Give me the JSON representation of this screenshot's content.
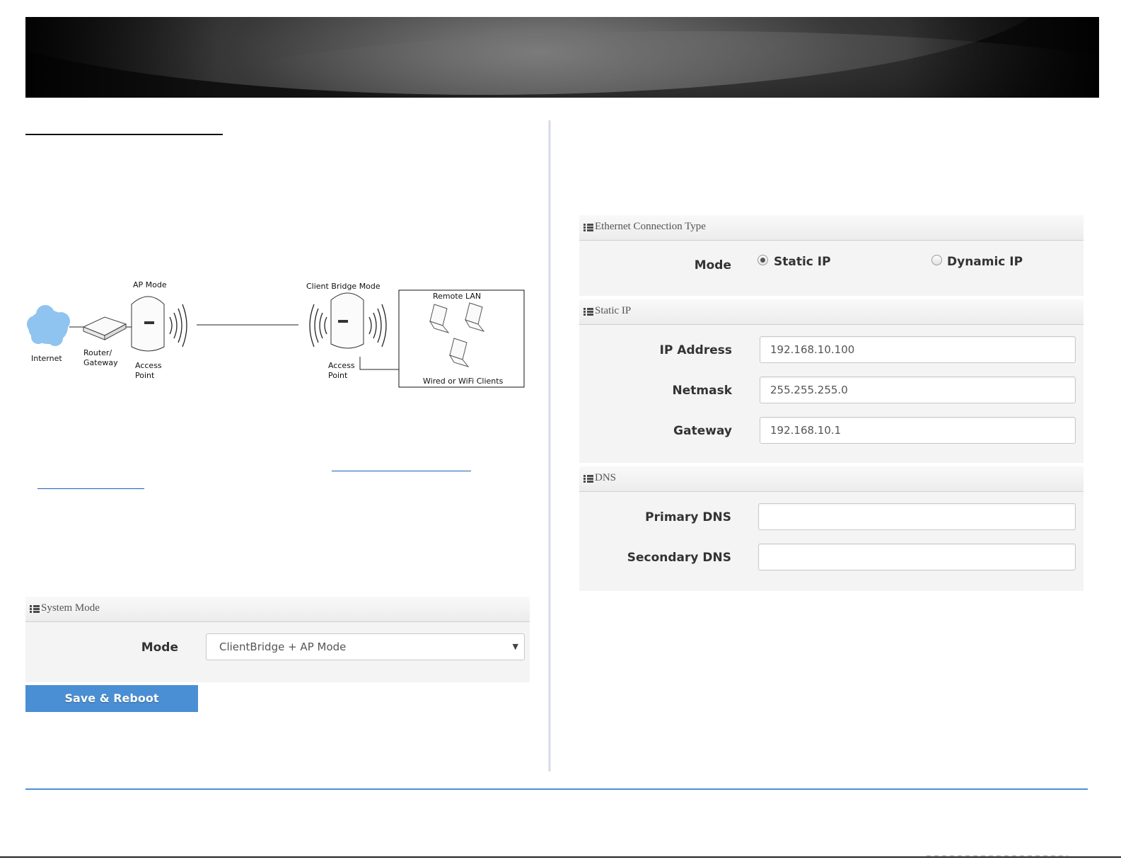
{
  "diagram": {
    "ap_mode_title": "AP Mode",
    "client_bridge_title": "Client Bridge Mode",
    "remote_lan_title": "Remote LAN",
    "internet_label": "Internet",
    "router_label_1": "Router/",
    "router_label_2": "Gateway",
    "access_point_label_1": "Access",
    "access_point_label_2": "Point",
    "wired_clients_label": "Wired or WiFi Clients"
  },
  "system_mode_panel": {
    "title": "System Mode",
    "mode_label": "Mode",
    "mode_value": "ClientBridge + AP Mode",
    "caret": "▼"
  },
  "save_button": {
    "label": "Save & Reboot"
  },
  "ethernet_panel": {
    "title": "Ethernet Connection Type",
    "mode_label": "Mode",
    "options": [
      {
        "label": "Static IP",
        "selected": true
      },
      {
        "label": "Dynamic IP",
        "selected": false
      }
    ]
  },
  "static_ip_panel": {
    "title": "Static IP",
    "ip_label": "IP Address",
    "ip_value": "192.168.10.100",
    "netmask_label": "Netmask",
    "netmask_value": "255.255.255.0",
    "gateway_label": "Gateway",
    "gateway_value": "192.168.10.1"
  },
  "dns_panel": {
    "title": "DNS",
    "primary_label": "Primary DNS",
    "primary_value": "",
    "secondary_label": "Secondary DNS",
    "secondary_value": ""
  },
  "colors": {
    "accent": "#4a8fd4",
    "footer_rule": "#4d8fd6",
    "link": "#1a5fb4",
    "cloud": "#8fc3f0"
  },
  "icons": {
    "panel_header": "list-icon",
    "select_caret": "chevron-down-icon"
  }
}
